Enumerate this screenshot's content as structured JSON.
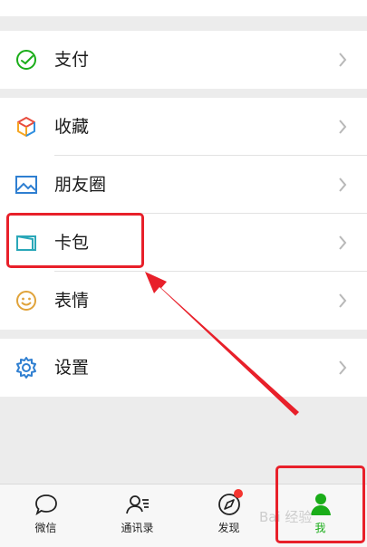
{
  "menu": {
    "pay": {
      "label": "支付",
      "icon": "wallet-pay-icon"
    },
    "favorites": {
      "label": "收藏",
      "icon": "cube-favorites-icon"
    },
    "moments": {
      "label": "朋友圈",
      "icon": "picture-moments-icon"
    },
    "cards": {
      "label": "卡包",
      "icon": "card-wallet-icon"
    },
    "stickers": {
      "label": "表情",
      "icon": "smiley-icon"
    },
    "settings": {
      "label": "设置",
      "icon": "gear-icon"
    }
  },
  "tabbar": {
    "tabs": [
      {
        "label": "微信",
        "icon": "chat-bubble-icon",
        "active": false
      },
      {
        "label": "通讯录",
        "icon": "contacts-icon",
        "active": false
      },
      {
        "label": "发现",
        "icon": "compass-icon",
        "active": false,
        "badge": true
      },
      {
        "label": "我",
        "icon": "person-icon",
        "active": true
      }
    ]
  },
  "annotation": {
    "highlight_color": "#e8202a",
    "target": "卡包"
  },
  "watermark": "Bai 经验",
  "colors": {
    "accent_green": "#1aad19",
    "badge_red": "#f43530"
  }
}
